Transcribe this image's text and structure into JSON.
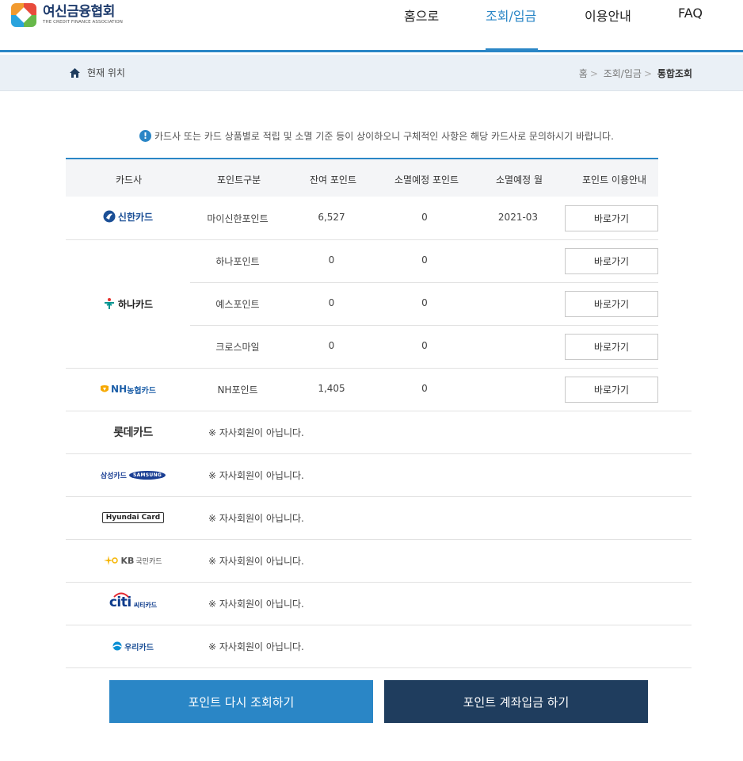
{
  "header": {
    "logo_title": "여신금융협회",
    "logo_sub": "THE CREDIT FINANCE ASSOCIATION",
    "nav": [
      "홈으로",
      "조회/입금",
      "이용안내",
      "FAQ"
    ],
    "active_nav": "조회/입금"
  },
  "location": {
    "label": "현재 위치",
    "breadcrumb": [
      "홈",
      "조회/입금",
      "통합조회"
    ]
  },
  "notice": "카드사 또는 카드 상품별로 적립 및 소멸 기준 등이 상이하오니 구체적인 사항은 해당 카드사로 문의하시기 바랍니다.",
  "table": {
    "headers": [
      "카드사",
      "포인트구분",
      "잔여 포인트",
      "소멸예정 포인트",
      "소멸예정 월",
      "포인트 이용안내"
    ],
    "button_label": "바로가기",
    "groups": [
      {
        "brand": "신한카드",
        "rows": [
          {
            "type": "마이신한포인트",
            "balance": "6,527",
            "expiring": "0",
            "month": "2021-03"
          }
        ]
      },
      {
        "brand": "하나카드",
        "rows": [
          {
            "type": "하나포인트",
            "balance": "0",
            "expiring": "0",
            "month": ""
          },
          {
            "type": "예스포인트",
            "balance": "0",
            "expiring": "0",
            "month": ""
          },
          {
            "type": "크로스마일",
            "balance": "0",
            "expiring": "0",
            "month": ""
          }
        ]
      },
      {
        "brand": "NH농협카드",
        "rows": [
          {
            "type": "NH포인트",
            "balance": "1,405",
            "expiring": "0",
            "month": ""
          }
        ]
      }
    ],
    "non_member_text": "※ 자사회원이 아닙니다.",
    "non_members": [
      "롯데카드",
      "삼성카드",
      "Hyundai Card",
      "KB국민카드",
      "citi 씨티카드",
      "우리카드"
    ]
  },
  "brands": {
    "shinhan": "신한카드",
    "hana": "하나카드",
    "nh_prefix": "NH",
    "nh_suffix": "농협카드",
    "lotte": "롯데카드",
    "samsung": "삼성카드",
    "samsung_en": "SAMSUNG",
    "hyundai": "Hyundai Card",
    "kb_prefix": "KB",
    "kb_suffix": "국민카드",
    "citi": "citi",
    "citi_kr": "씨티카드",
    "woori": "우리카드"
  },
  "buttons": {
    "refresh": "포인트 다시 조회하기",
    "deposit": "포인트 계좌입금 하기"
  },
  "colors": {
    "accent": "#2a86c6",
    "navy": "#1f3d5e"
  }
}
